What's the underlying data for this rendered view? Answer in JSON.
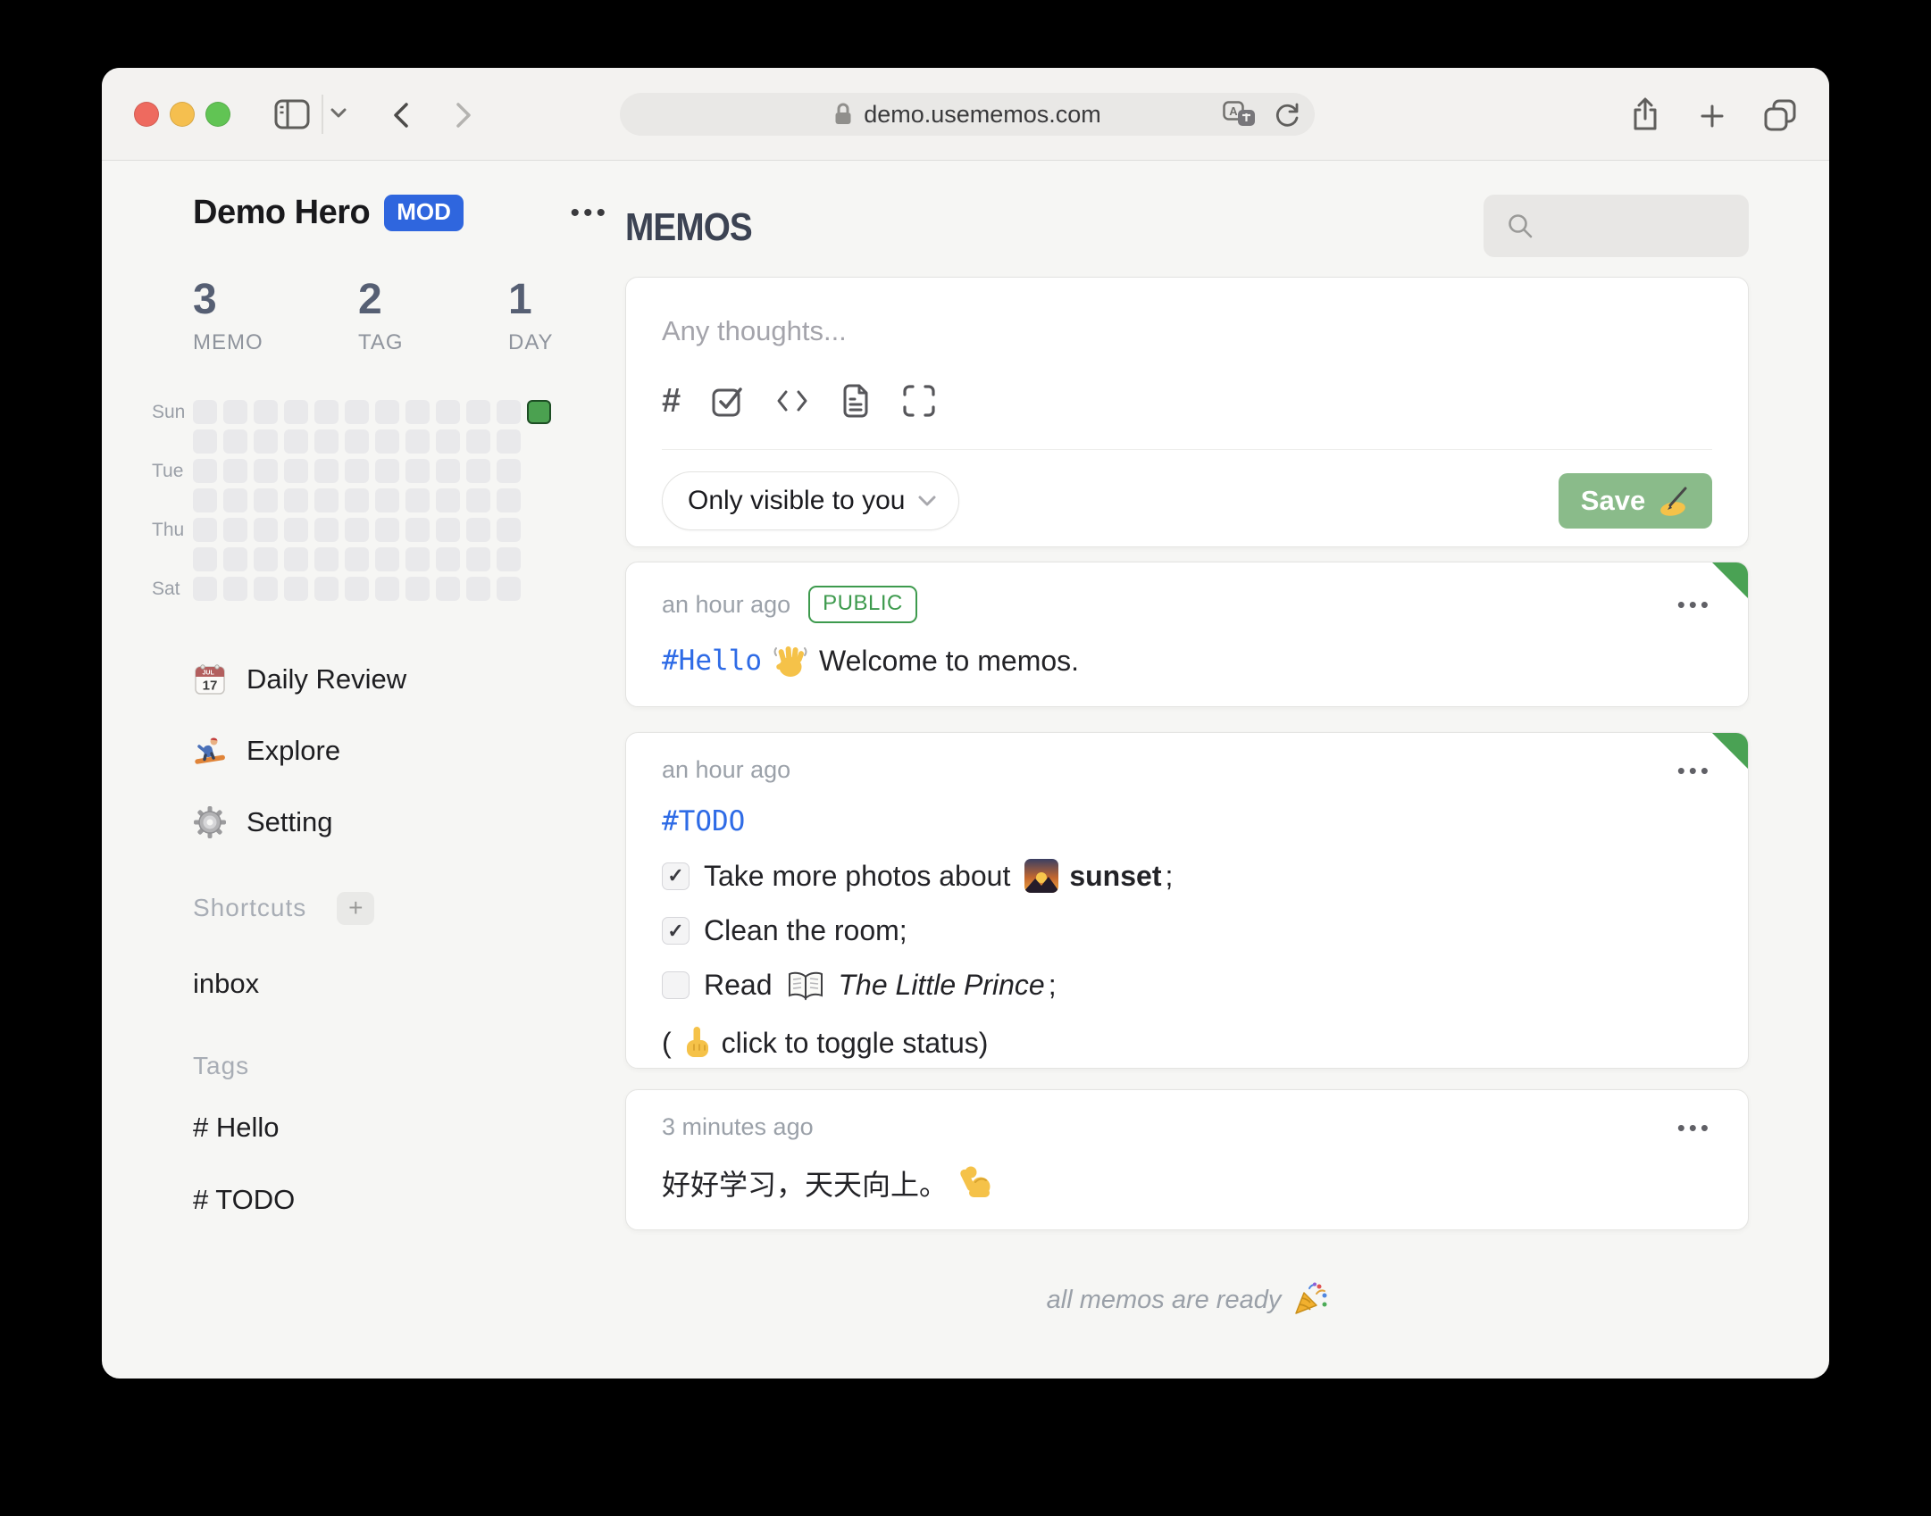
{
  "browser": {
    "url": "demo.usememos.com"
  },
  "colors": {
    "accent_blue": "#2f66de",
    "tag_blue": "#2e6be6",
    "badge_green": "#3d9a4d",
    "ribbon_green": "#4aa254",
    "save_green": "#8abb8a",
    "heat_active_green": "#4ba150"
  },
  "sidebar": {
    "user_name": "Demo Hero",
    "user_badge": "MOD",
    "stats": [
      {
        "value": "3",
        "label": "MEMO"
      },
      {
        "value": "2",
        "label": "TAG"
      },
      {
        "value": "1",
        "label": "DAY"
      }
    ],
    "calendar": {
      "day_labels": [
        "Sun",
        "Tue",
        "Thu",
        "Sat"
      ],
      "rows": 7,
      "cells_per_row": [
        12,
        11,
        11,
        11,
        11,
        11,
        11
      ],
      "active": {
        "row": 0,
        "col": 11
      }
    },
    "menu": [
      {
        "icon": "calendar-emoji",
        "label": "Daily Review"
      },
      {
        "icon": "snowboarder-emoji",
        "label": "Explore"
      },
      {
        "icon": "gear-emoji",
        "label": "Setting"
      }
    ],
    "shortcuts_title": "Shortcuts",
    "shortcut_items": [
      "inbox"
    ],
    "tags_title": "Tags",
    "tag_items": [
      "# Hello",
      "# TODO"
    ]
  },
  "main": {
    "title": "MEMOS",
    "composer": {
      "placeholder": "Any thoughts...",
      "toolbar_icons": [
        "hashtag-icon",
        "checkbox-icon",
        "code-icon",
        "template-icon",
        "fullscreen-icon"
      ],
      "visibility": "Only visible to you",
      "save_label": "Save"
    },
    "memos": [
      {
        "time": "an hour ago",
        "badge": "PUBLIC",
        "tag": "#Hello",
        "text": "Welcome to memos."
      },
      {
        "time": "an hour ago",
        "tag": "#TODO",
        "tasks": [
          {
            "checked": true,
            "before": "Take more photos about",
            "bold": "sunset",
            "after": ";"
          },
          {
            "checked": true,
            "before": "Clean the room;"
          },
          {
            "checked": false,
            "before": "Read",
            "italic": "The Little Prince",
            "after": ";"
          }
        ],
        "hint_prefix": "(",
        "hint_text": "click to toggle status)"
      },
      {
        "time": "3 minutes ago",
        "text": "好好学习，天天向上。"
      }
    ],
    "footer": "all memos are ready"
  }
}
